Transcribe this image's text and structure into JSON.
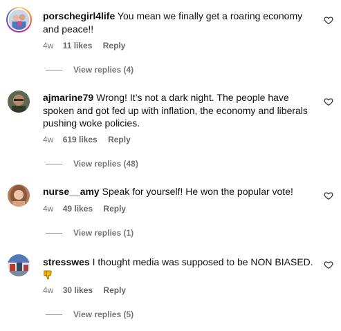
{
  "comments": [
    {
      "username": "porschegirl4life",
      "text": "You mean we finally get a roaring economy and peace!!",
      "time": "4w",
      "likes": "11 likes",
      "reply": "Reply",
      "view_replies": "View replies (4)",
      "avatar_icon": "avatar-story-ring"
    },
    {
      "username": "ajmarine79",
      "text": "Wrong! It’s not a dark night. The people have spoken and got fed up with inflation, the economy and liberals pushing woke policies.",
      "time": "4w",
      "likes": "619 likes",
      "reply": "Reply",
      "view_replies": "View replies (48)",
      "avatar_icon": "avatar"
    },
    {
      "username": "nurse__amy",
      "text": "Speak for yourself! He won the popular vote!",
      "time": "4w",
      "likes": "49 likes",
      "reply": "Reply",
      "view_replies": "View replies (1)",
      "avatar_icon": "avatar"
    },
    {
      "username": "stresswes",
      "text": "I thought media was supposed to be NON BIASED.",
      "emoji": "thumbs-down",
      "time": "4w",
      "likes": "30 likes",
      "reply": "Reply",
      "view_replies": "View replies (5)",
      "avatar_icon": "avatar"
    }
  ],
  "colors": {
    "text": "#111111",
    "meta": "#666666",
    "divider": "#8e8e8e",
    "emoji": "#f4b400"
  }
}
